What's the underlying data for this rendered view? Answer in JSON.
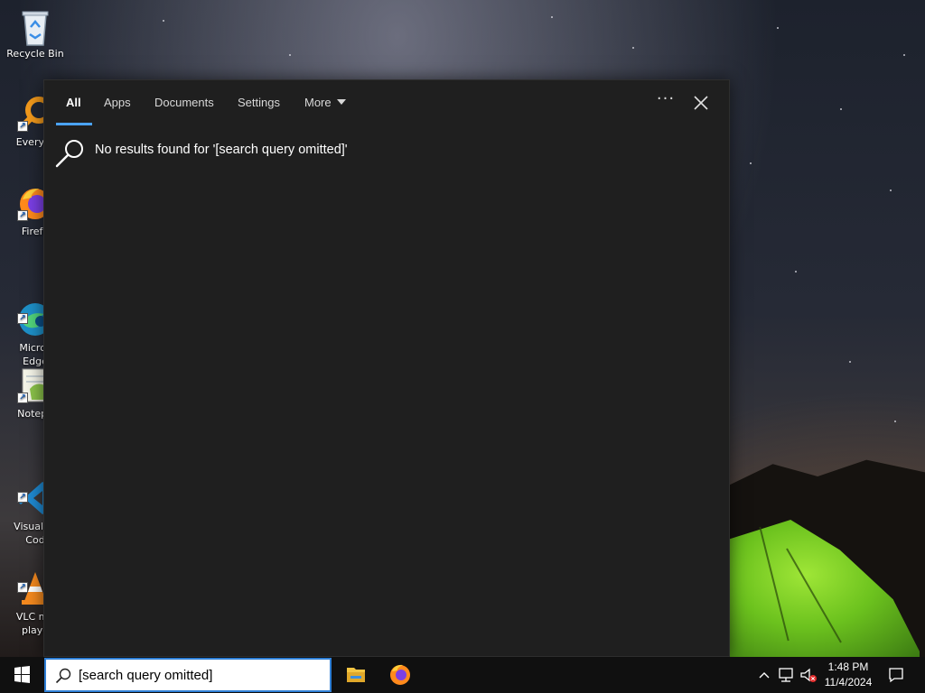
{
  "desktop": {
    "icons": [
      {
        "label": "Recycle Bin"
      },
      {
        "label": "Everyth"
      },
      {
        "label": "Firefo"
      },
      {
        "label": "Micros\nEdge"
      },
      {
        "label": "Notepa"
      },
      {
        "label": "Visual St\nCod"
      },
      {
        "label": "VLC me\nplaye"
      }
    ]
  },
  "search_panel": {
    "tabs": [
      {
        "label": "All",
        "active": true
      },
      {
        "label": "Apps"
      },
      {
        "label": "Documents"
      },
      {
        "label": "Settings"
      },
      {
        "label": "More"
      }
    ],
    "options_icon": "ellipsis-icon",
    "close_icon": "close-icon",
    "message": "No results found for '[search query omitted]'"
  },
  "taskbar": {
    "search_value": "[search query omitted]",
    "apps": [
      "file-explorer-icon",
      "firefox-icon"
    ],
    "clock": {
      "time": "1:48 PM",
      "date": "11/4/2024"
    }
  },
  "colors": {
    "accent": "#4aa3ff",
    "panel_bg": "#1f1f1f",
    "taskbar_bg": "#101010"
  }
}
